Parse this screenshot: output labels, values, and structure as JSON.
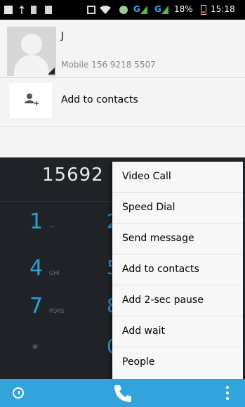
{
  "status_bar": {
    "network_1": "G",
    "network_2": "G",
    "battery": "18%",
    "time": "15:18"
  },
  "contact": {
    "name": "J",
    "number": "Mobile 156 9218 5507",
    "add_to_contacts": "Add to contacts"
  },
  "dialer": {
    "digits": "15692",
    "keys": [
      {
        "digit": "1",
        "sub": "—"
      },
      {
        "digit": "4",
        "sub": "GHI"
      },
      {
        "digit": "7",
        "sub": "PQRS"
      },
      {
        "digit": "*",
        "sub": ""
      }
    ]
  },
  "menu": {
    "items": [
      "Video Call",
      "Speed Dial",
      "Send message",
      "Add to contacts",
      "Add 2-sec pause",
      "Add wait",
      "People"
    ]
  },
  "colors": {
    "accent": "#33a4db",
    "dialpad_bg": "#202428",
    "menu_bg": "#f7f7f7"
  }
}
